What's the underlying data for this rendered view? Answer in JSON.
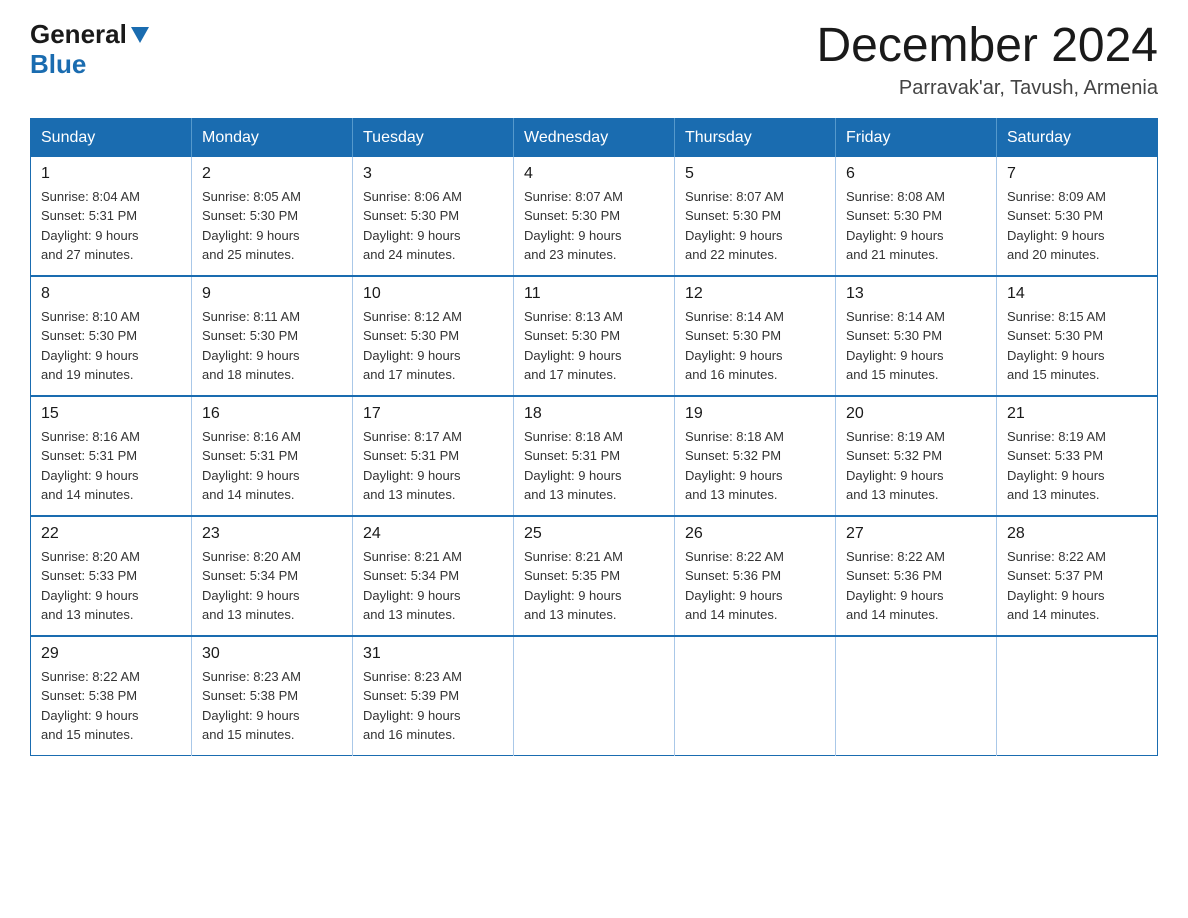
{
  "logo": {
    "general": "General",
    "blue": "Blue"
  },
  "title": "December 2024",
  "subtitle": "Parravak'ar, Tavush, Armenia",
  "days_header": [
    "Sunday",
    "Monday",
    "Tuesday",
    "Wednesday",
    "Thursday",
    "Friday",
    "Saturday"
  ],
  "weeks": [
    [
      {
        "day": "1",
        "sunrise": "8:04 AM",
        "sunset": "5:31 PM",
        "daylight": "9 hours and 27 minutes."
      },
      {
        "day": "2",
        "sunrise": "8:05 AM",
        "sunset": "5:30 PM",
        "daylight": "9 hours and 25 minutes."
      },
      {
        "day": "3",
        "sunrise": "8:06 AM",
        "sunset": "5:30 PM",
        "daylight": "9 hours and 24 minutes."
      },
      {
        "day": "4",
        "sunrise": "8:07 AM",
        "sunset": "5:30 PM",
        "daylight": "9 hours and 23 minutes."
      },
      {
        "day": "5",
        "sunrise": "8:07 AM",
        "sunset": "5:30 PM",
        "daylight": "9 hours and 22 minutes."
      },
      {
        "day": "6",
        "sunrise": "8:08 AM",
        "sunset": "5:30 PM",
        "daylight": "9 hours and 21 minutes."
      },
      {
        "day": "7",
        "sunrise": "8:09 AM",
        "sunset": "5:30 PM",
        "daylight": "9 hours and 20 minutes."
      }
    ],
    [
      {
        "day": "8",
        "sunrise": "8:10 AM",
        "sunset": "5:30 PM",
        "daylight": "9 hours and 19 minutes."
      },
      {
        "day": "9",
        "sunrise": "8:11 AM",
        "sunset": "5:30 PM",
        "daylight": "9 hours and 18 minutes."
      },
      {
        "day": "10",
        "sunrise": "8:12 AM",
        "sunset": "5:30 PM",
        "daylight": "9 hours and 17 minutes."
      },
      {
        "day": "11",
        "sunrise": "8:13 AM",
        "sunset": "5:30 PM",
        "daylight": "9 hours and 17 minutes."
      },
      {
        "day": "12",
        "sunrise": "8:14 AM",
        "sunset": "5:30 PM",
        "daylight": "9 hours and 16 minutes."
      },
      {
        "day": "13",
        "sunrise": "8:14 AM",
        "sunset": "5:30 PM",
        "daylight": "9 hours and 15 minutes."
      },
      {
        "day": "14",
        "sunrise": "8:15 AM",
        "sunset": "5:30 PM",
        "daylight": "9 hours and 15 minutes."
      }
    ],
    [
      {
        "day": "15",
        "sunrise": "8:16 AM",
        "sunset": "5:31 PM",
        "daylight": "9 hours and 14 minutes."
      },
      {
        "day": "16",
        "sunrise": "8:16 AM",
        "sunset": "5:31 PM",
        "daylight": "9 hours and 14 minutes."
      },
      {
        "day": "17",
        "sunrise": "8:17 AM",
        "sunset": "5:31 PM",
        "daylight": "9 hours and 13 minutes."
      },
      {
        "day": "18",
        "sunrise": "8:18 AM",
        "sunset": "5:31 PM",
        "daylight": "9 hours and 13 minutes."
      },
      {
        "day": "19",
        "sunrise": "8:18 AM",
        "sunset": "5:32 PM",
        "daylight": "9 hours and 13 minutes."
      },
      {
        "day": "20",
        "sunrise": "8:19 AM",
        "sunset": "5:32 PM",
        "daylight": "9 hours and 13 minutes."
      },
      {
        "day": "21",
        "sunrise": "8:19 AM",
        "sunset": "5:33 PM",
        "daylight": "9 hours and 13 minutes."
      }
    ],
    [
      {
        "day": "22",
        "sunrise": "8:20 AM",
        "sunset": "5:33 PM",
        "daylight": "9 hours and 13 minutes."
      },
      {
        "day": "23",
        "sunrise": "8:20 AM",
        "sunset": "5:34 PM",
        "daylight": "9 hours and 13 minutes."
      },
      {
        "day": "24",
        "sunrise": "8:21 AM",
        "sunset": "5:34 PM",
        "daylight": "9 hours and 13 minutes."
      },
      {
        "day": "25",
        "sunrise": "8:21 AM",
        "sunset": "5:35 PM",
        "daylight": "9 hours and 13 minutes."
      },
      {
        "day": "26",
        "sunrise": "8:22 AM",
        "sunset": "5:36 PM",
        "daylight": "9 hours and 14 minutes."
      },
      {
        "day": "27",
        "sunrise": "8:22 AM",
        "sunset": "5:36 PM",
        "daylight": "9 hours and 14 minutes."
      },
      {
        "day": "28",
        "sunrise": "8:22 AM",
        "sunset": "5:37 PM",
        "daylight": "9 hours and 14 minutes."
      }
    ],
    [
      {
        "day": "29",
        "sunrise": "8:22 AM",
        "sunset": "5:38 PM",
        "daylight": "9 hours and 15 minutes."
      },
      {
        "day": "30",
        "sunrise": "8:23 AM",
        "sunset": "5:38 PM",
        "daylight": "9 hours and 15 minutes."
      },
      {
        "day": "31",
        "sunrise": "8:23 AM",
        "sunset": "5:39 PM",
        "daylight": "9 hours and 16 minutes."
      },
      null,
      null,
      null,
      null
    ]
  ]
}
